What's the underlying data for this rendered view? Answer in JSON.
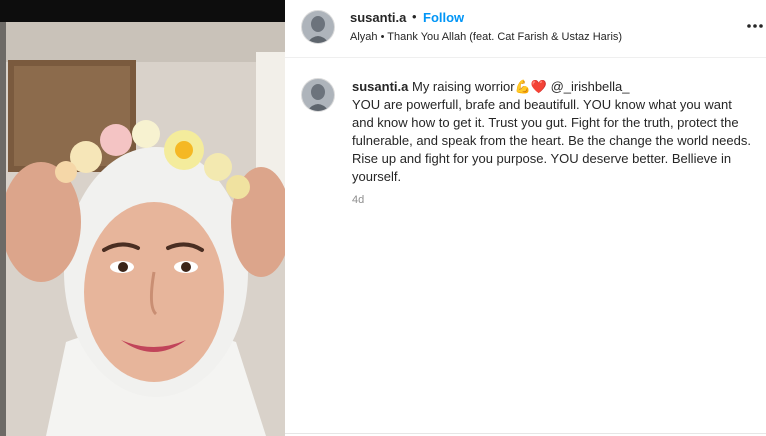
{
  "post": {
    "username": "susanti.a",
    "dot": "•",
    "follow_label": "Follow",
    "audio": "Alyah • Thank You Allah (feat. Cat Farish & Ustaz Haris)",
    "more_icon": "more-horizontal-icon"
  },
  "caption": {
    "username": "susanti.a",
    "lead": "My raising worrior",
    "emoji_flex": "💪",
    "emoji_heart": "❤️",
    "mention": "@_irishbella_",
    "body": "YOU are powerfull, brafe and beautifull. YOU know what you want and know how to get it. Trust you gut. Fight for the truth, protect the fulnerable, and speak from the heart. Be the change the world needs. Rise up and fight for you purpose. YOU deserve better. Bellieve in yourself.",
    "time": "4d"
  },
  "colors": {
    "follow": "#0095f6",
    "text": "#262626",
    "muted": "#8e8e8e",
    "heart": "#e0245e"
  }
}
